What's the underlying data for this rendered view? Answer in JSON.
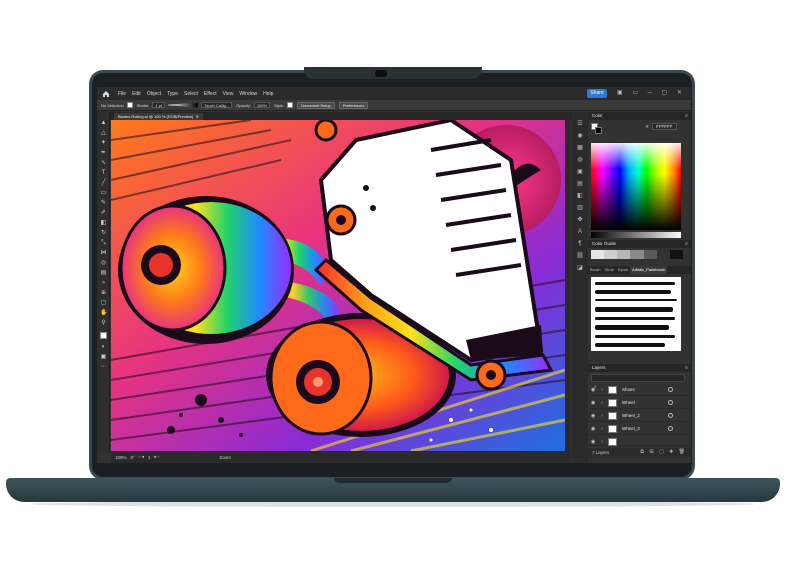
{
  "app": {
    "menu": [
      "File",
      "Edit",
      "Object",
      "Type",
      "Select",
      "Effect",
      "View",
      "Window",
      "Help"
    ],
    "share_label": "Share"
  },
  "control_bar": {
    "selection": "No Selection",
    "stroke_label": "Stroke:",
    "stroke_value": "1 pt",
    "brush_name": "Touch Callig...",
    "opacity_label": "Opacity:",
    "opacity_value": "100%",
    "style_label": "Style:",
    "document_setup": "Document Setup",
    "preferences": "Preferences"
  },
  "document": {
    "tab_title": "Blades Rolling.ai @ 100 % (RGB/Preview)"
  },
  "status_bar": {
    "zoom": "100%",
    "rotation": "0°",
    "artboard": "1",
    "tool": "Zoom"
  },
  "panels": {
    "color_title": "Color",
    "hex_value": "FFFFFF",
    "color_guide_title": "Color Guide",
    "brush_tabs": [
      "Brush",
      "Strok",
      "Symb",
      "Artistic_Paintbrush"
    ],
    "brush_active": 3,
    "layers_title": "Layers",
    "layers": [
      {
        "name": "Shoes"
      },
      {
        "name": "Wheel"
      },
      {
        "name": "Wheel_2"
      },
      {
        "name": "Wheel_3"
      },
      {
        "name": ""
      }
    ],
    "layers_count": "7 Layers"
  },
  "colors": {
    "laptop": "#3b4a50",
    "share": "#2f7ad1",
    "ui_dark": "#323232"
  }
}
